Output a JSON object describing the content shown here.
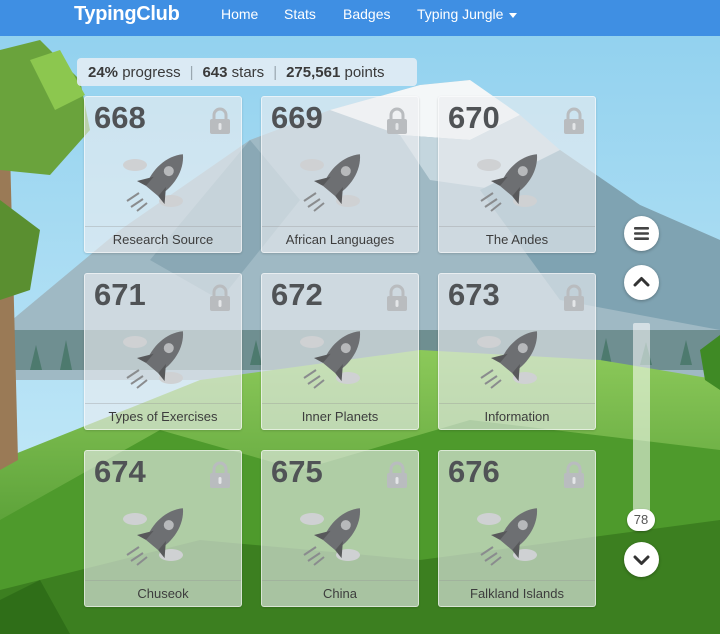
{
  "nav": {
    "brand": "TypingClub",
    "links": [
      "Home",
      "Stats",
      "Badges",
      "Typing Jungle"
    ]
  },
  "stats": {
    "progress_value": "24%",
    "progress_label": "progress",
    "stars_value": "643",
    "stars_label": "stars",
    "points_value": "275,561",
    "points_label": "points"
  },
  "lessons": [
    {
      "number": "668",
      "name": "Research Source"
    },
    {
      "number": "669",
      "name": "African Languages"
    },
    {
      "number": "670",
      "name": "The Andes"
    },
    {
      "number": "671",
      "name": "Types of Exercises"
    },
    {
      "number": "672",
      "name": "Inner Planets"
    },
    {
      "number": "673",
      "name": "Information"
    },
    {
      "number": "674",
      "name": "Chuseok"
    },
    {
      "number": "675",
      "name": "China"
    },
    {
      "number": "676",
      "name": "Falkland Islands"
    }
  ],
  "scroll": {
    "position_label": "78"
  },
  "icons": {
    "menu": "hamburger-icon",
    "up": "chevron-up-icon",
    "down": "chevron-down-icon",
    "lock": "lock-icon",
    "rocket": "rocket-icon"
  },
  "colors": {
    "navbar": "#3f8fe3",
    "sky": "#9fd6f0",
    "grass": "#5aa532"
  }
}
